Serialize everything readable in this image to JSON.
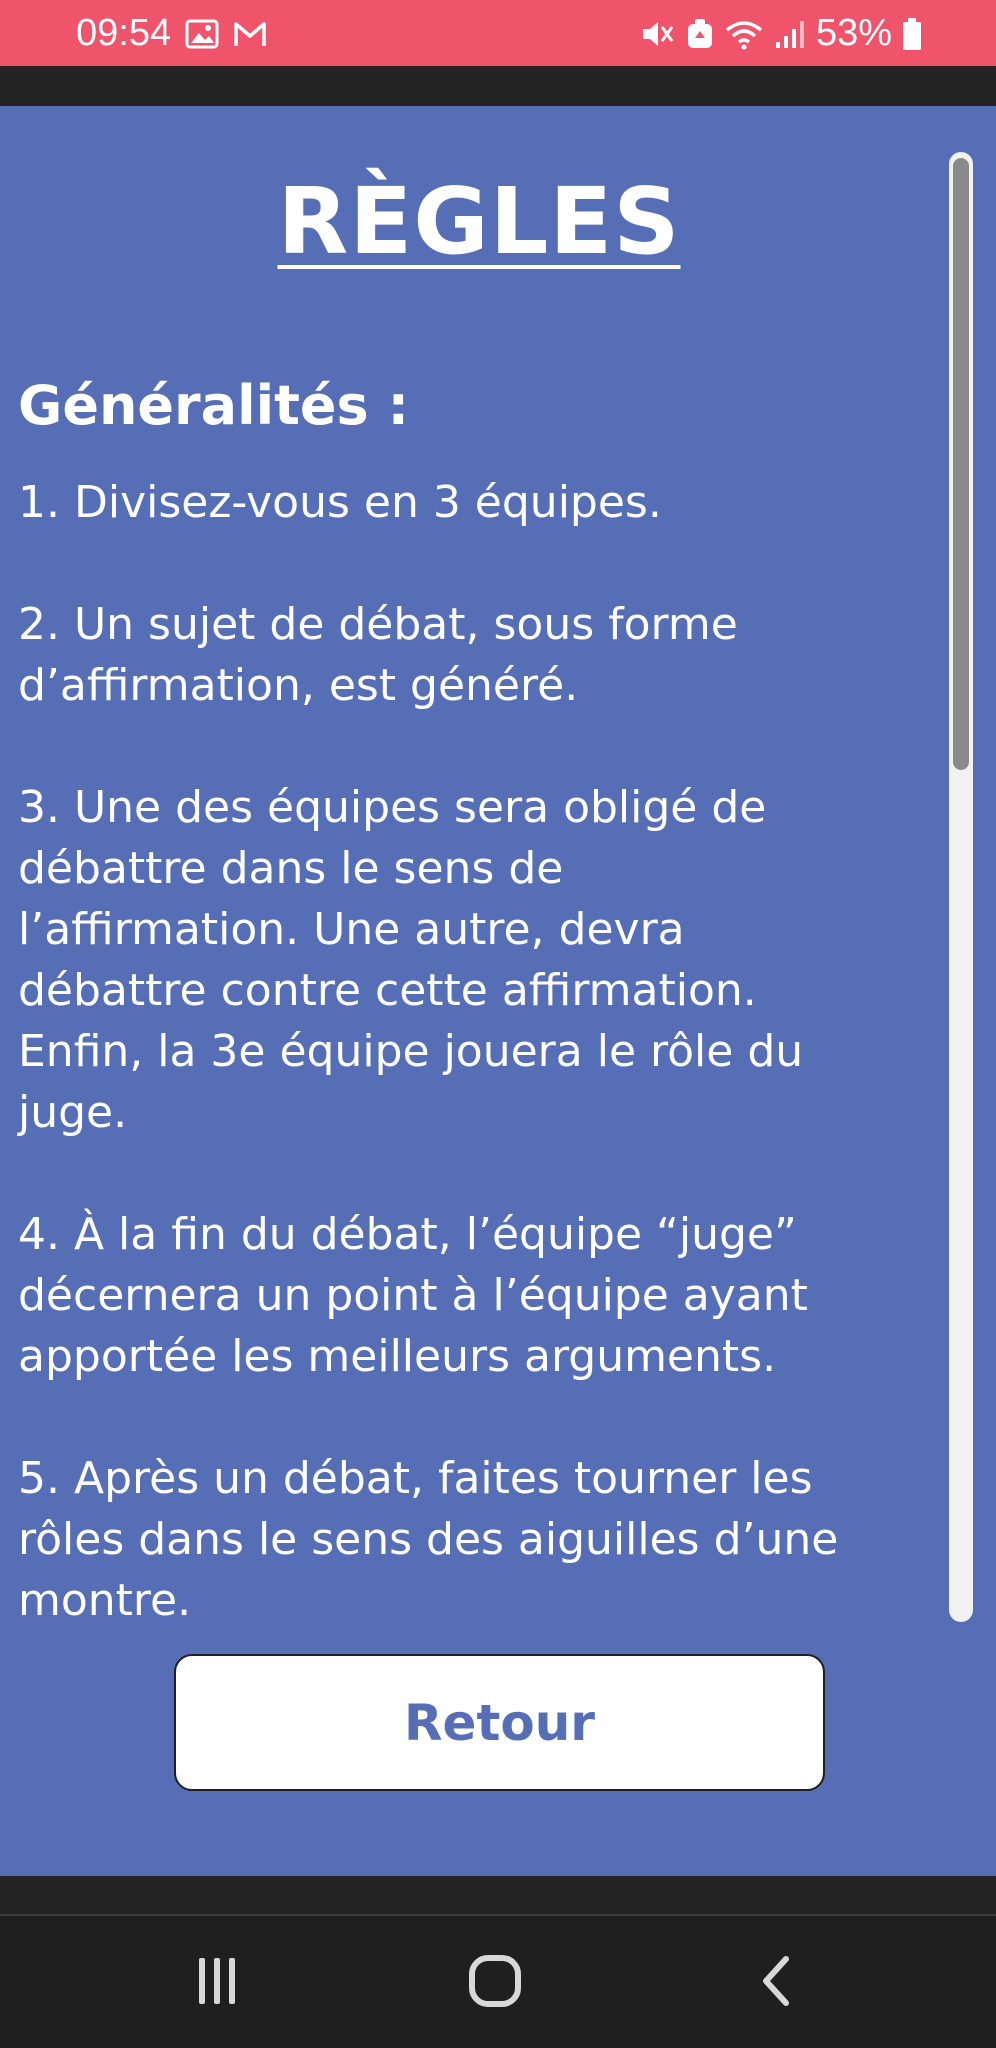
{
  "status_bar": {
    "time": "09:54",
    "battery": "53%",
    "icons": [
      "gallery-icon",
      "gmail-icon",
      "mute-icon",
      "cleaner-icon",
      "wifi-icon",
      "signal-icon",
      "battery-icon"
    ]
  },
  "page": {
    "title": "RÈGLES",
    "section_title": "Généralités :",
    "rules": [
      "1. Divisez-vous en 3 équipes.",
      "2. Un sujet de débat, sous forme\nd’affirmation, est généré.",
      "3. Une des équipes sera obligé de\ndébattre dans le sens de\nl’affirmation. Une autre, devra\ndébattre contre cette affirmation.\nEnfin, la 3e équipe jouera le rôle du\njuge.",
      "4. À la fin du débat, l’équipe “juge”\ndécernera un point à l’équipe ayant\napportée les meilleurs arguments.",
      "5. Après un débat, faites tourner les\nrôles dans le sens des aiguilles d’une\nmontre."
    ],
    "back_button_label": "Retour"
  },
  "nav_bar": {
    "icons": [
      "recent-apps-icon",
      "home-icon",
      "back-icon"
    ]
  },
  "colors": {
    "status_bar": "#f0546a",
    "background": "#556eb5",
    "button_text": "#556eb5"
  }
}
